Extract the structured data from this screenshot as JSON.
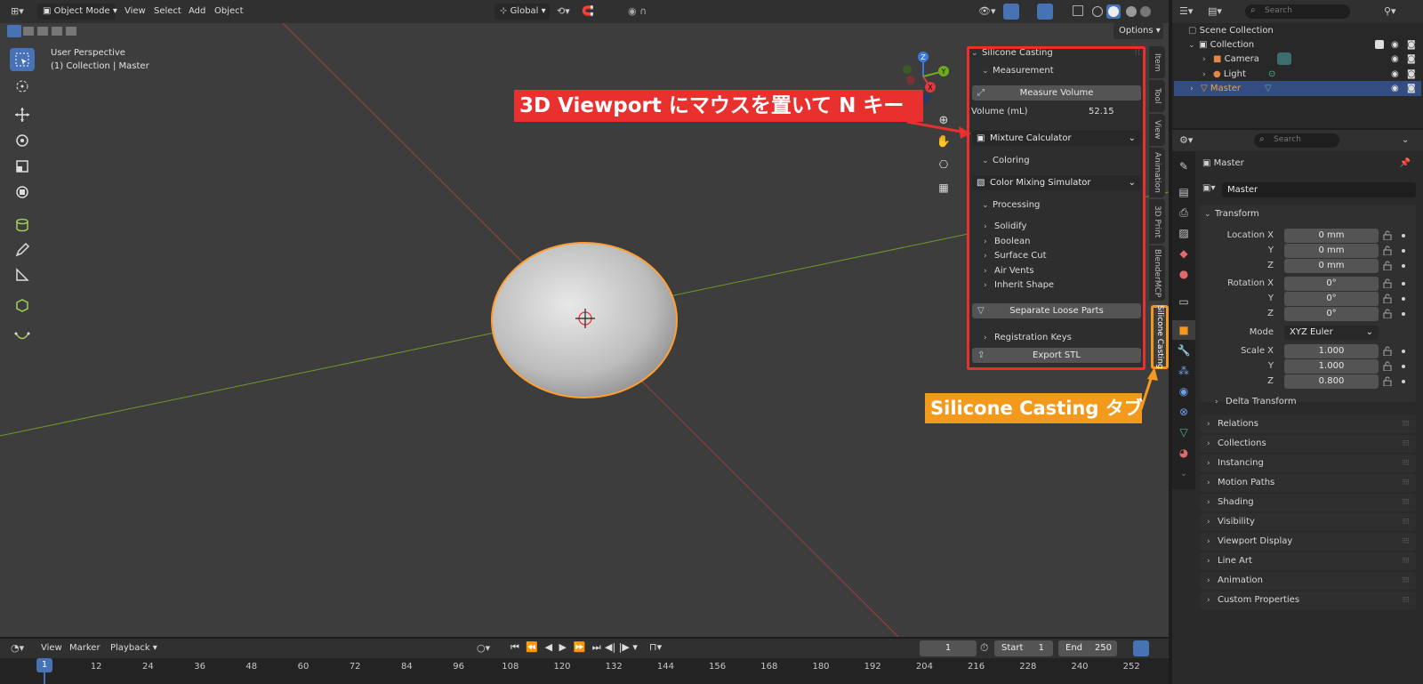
{
  "viewport_header": {
    "mode": "Object Mode",
    "menus": [
      "View",
      "Select",
      "Add",
      "Object"
    ],
    "transform_orientation": "Global",
    "options_label": "Options"
  },
  "viewport_overlay": {
    "view_name": "User Perspective",
    "collection_line": "(1) Collection | Master"
  },
  "n_panel": {
    "tabs": [
      "Item",
      "Tool",
      "View",
      "Animation",
      "3D Print",
      "BlenderMCP",
      "Silicone Casting"
    ],
    "active_tab": "Silicone Casting",
    "title": "Silicone Casting",
    "measurement_label": "Measurement",
    "measure_button": "Measure Volume",
    "volume_label": "Volume (mL)",
    "volume_value": "52.15",
    "mixture_dropdown": "Mixture Calculator",
    "coloring_label": "Coloring",
    "color_dropdown": "Color Mixing Simulator",
    "processing_label": "Processing",
    "processing_items": [
      "Solidify",
      "Boolean",
      "Surface Cut",
      "Air Vents",
      "Inherit Shape"
    ],
    "separate_button": "Separate Loose Parts",
    "registration_label": "Registration Keys",
    "export_button": "Export STL"
  },
  "callouts": {
    "red": "3D Viewport にマウスを置いて N キー",
    "orange": "Silicone Casting タブ"
  },
  "colors": {
    "red": "#e8302f",
    "orange": "#f39a1c",
    "accent_blue": "#4772b3",
    "selected_outline": "#ffa030"
  },
  "outliner": {
    "search_placeholder": "Search",
    "scene_collection": "Scene Collection",
    "collection": "Collection",
    "items": [
      "Camera",
      "Light",
      "Master"
    ]
  },
  "properties": {
    "search_placeholder": "Search",
    "object_name_header": "Master",
    "object_name_field": "Master",
    "transform_label": "Transform",
    "location": {
      "label": "Location X",
      "x": "0 mm",
      "y": "0 mm",
      "z": "0 mm"
    },
    "rotation": {
      "label": "Rotation X",
      "x": "0°",
      "y": "0°",
      "z": "0°"
    },
    "mode_label": "Mode",
    "mode_value": "XYZ Euler",
    "scale": {
      "label": "Scale X",
      "x": "1.000",
      "y": "1.000",
      "z": "0.800"
    },
    "axis_y": "Y",
    "axis_z": "Z",
    "delta_transform": "Delta Transform",
    "sections": [
      "Relations",
      "Collections",
      "Instancing",
      "Motion Paths",
      "Shading",
      "Visibility",
      "Viewport Display",
      "Line Art",
      "Animation",
      "Custom Properties"
    ]
  },
  "timeline": {
    "menus": [
      "View",
      "Marker",
      "Playback"
    ],
    "current_frame": "1",
    "start_label": "Start",
    "start_value": "1",
    "end_label": "End",
    "end_value": "250",
    "ruler": [
      "1",
      "12",
      "24",
      "36",
      "48",
      "60",
      "72",
      "84",
      "96",
      "108",
      "120",
      "132",
      "144",
      "156",
      "168",
      "180",
      "192",
      "204",
      "216",
      "228",
      "240",
      "252"
    ]
  },
  "gizmo": {
    "x": "X",
    "y": "Y",
    "z": "Z"
  }
}
